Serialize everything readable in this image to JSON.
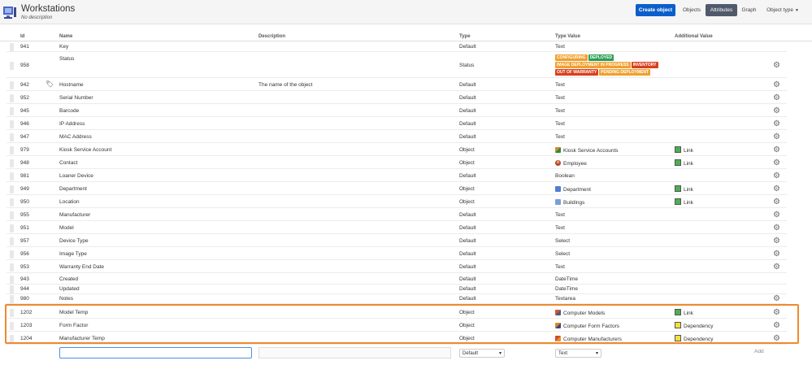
{
  "header": {
    "title": "Workstations",
    "subtitle": "No description",
    "create_button": "Create object",
    "nav": {
      "objects": "Objects",
      "attributes": "Attributes",
      "graph": "Graph",
      "object_type": "Object type"
    }
  },
  "columns": {
    "id": "Id",
    "name": "Name",
    "description": "Description",
    "type": "Type",
    "type_value": "Type Value",
    "additional": "Additional Value"
  },
  "rows": [
    {
      "id": "941",
      "name": "Key",
      "description": "",
      "type": "Default",
      "type_value": "Text",
      "gear": false
    },
    {
      "id": "958",
      "name": "Status",
      "description": "",
      "type": "Status",
      "type_value": "",
      "gear": true
    },
    {
      "id": "942",
      "name": "Hostname",
      "description": "The name of the object",
      "type": "Default",
      "type_value": "Text",
      "gear": true
    },
    {
      "id": "952",
      "name": "Serial Number",
      "description": "",
      "type": "Default",
      "type_value": "Text",
      "gear": true
    },
    {
      "id": "945",
      "name": "Barcode",
      "description": "",
      "type": "Default",
      "type_value": "Text",
      "gear": true
    },
    {
      "id": "946",
      "name": "IP Address",
      "description": "",
      "type": "Default",
      "type_value": "Text",
      "gear": true
    },
    {
      "id": "947",
      "name": "MAC Address",
      "description": "",
      "type": "Default",
      "type_value": "Text",
      "gear": true
    },
    {
      "id": "979",
      "name": "Kiosk Service Account",
      "description": "",
      "type": "Object",
      "type_value": "Kiosk Service Accounts",
      "icon": "ksa",
      "additional": "Link",
      "swatch": "green",
      "gear": true
    },
    {
      "id": "948",
      "name": "Contact",
      "description": "",
      "type": "Object",
      "type_value": "Employee",
      "icon": "emp",
      "additional": "Link",
      "swatch": "green",
      "gear": true
    },
    {
      "id": "981",
      "name": "Loaner Device",
      "description": "",
      "type": "Default",
      "type_value": "Boolean",
      "gear": true
    },
    {
      "id": "949",
      "name": "Department",
      "description": "",
      "type": "Object",
      "type_value": "Department",
      "icon": "dep",
      "additional": "Link",
      "swatch": "green",
      "gear": true
    },
    {
      "id": "950",
      "name": "Location",
      "description": "",
      "type": "Object",
      "type_value": "Buildings",
      "icon": "bld",
      "additional": "Link",
      "swatch": "green",
      "gear": true
    },
    {
      "id": "955",
      "name": "Manufacturer",
      "description": "",
      "type": "Default",
      "type_value": "Text",
      "gear": true
    },
    {
      "id": "951",
      "name": "Model",
      "description": "",
      "type": "Default",
      "type_value": "Text",
      "gear": true
    },
    {
      "id": "957",
      "name": "Device Type",
      "description": "",
      "type": "Default",
      "type_value": "Select",
      "gear": true
    },
    {
      "id": "956",
      "name": "Image Type",
      "description": "",
      "type": "Default",
      "type_value": "Select",
      "gear": true
    },
    {
      "id": "953",
      "name": "Warranty End Date",
      "description": "",
      "type": "Default",
      "type_value": "Text",
      "gear": true
    },
    {
      "id": "943",
      "name": "Created",
      "description": "",
      "type": "Default",
      "type_value": "DateTime",
      "gear": false
    },
    {
      "id": "944",
      "name": "Updated",
      "description": "",
      "type": "Default",
      "type_value": "DateTime",
      "gear": false
    },
    {
      "id": "980",
      "name": "Notes",
      "description": "",
      "type": "Default",
      "type_value": "Textarea",
      "gear": true
    },
    {
      "id": "1202",
      "name": "Model Temp",
      "description": "",
      "type": "Object",
      "type_value": "Computer Models",
      "icon": "cm",
      "additional": "Link",
      "swatch": "green",
      "gear": true
    },
    {
      "id": "1203",
      "name": "Form Factor",
      "description": "",
      "type": "Object",
      "type_value": "Computer Form Factors",
      "icon": "cf",
      "additional": "Dependency",
      "swatch": "yellow",
      "gear": true
    },
    {
      "id": "1204",
      "name": "Manufacturer Temp",
      "description": "",
      "type": "Object",
      "type_value": "Computer Manufacturers",
      "icon": "cmf",
      "additional": "Dependency",
      "swatch": "yellow",
      "gear": true
    }
  ],
  "status_badges": [
    {
      "label": "Configuring",
      "color": "#f0a030"
    },
    {
      "label": "Deployed",
      "color": "#2e9e57"
    },
    {
      "label": "Image deployment in progress",
      "color": "#f0a030"
    },
    {
      "label": "Inventory",
      "color": "#d9401f"
    },
    {
      "label": "Out of warranty",
      "color": "#d9401f"
    },
    {
      "label": "Pending deployment",
      "color": "#f0a030"
    }
  ],
  "add_row": {
    "name_value": "",
    "type_select": "Default",
    "type_value_select": "Text",
    "add_label": "Add"
  }
}
